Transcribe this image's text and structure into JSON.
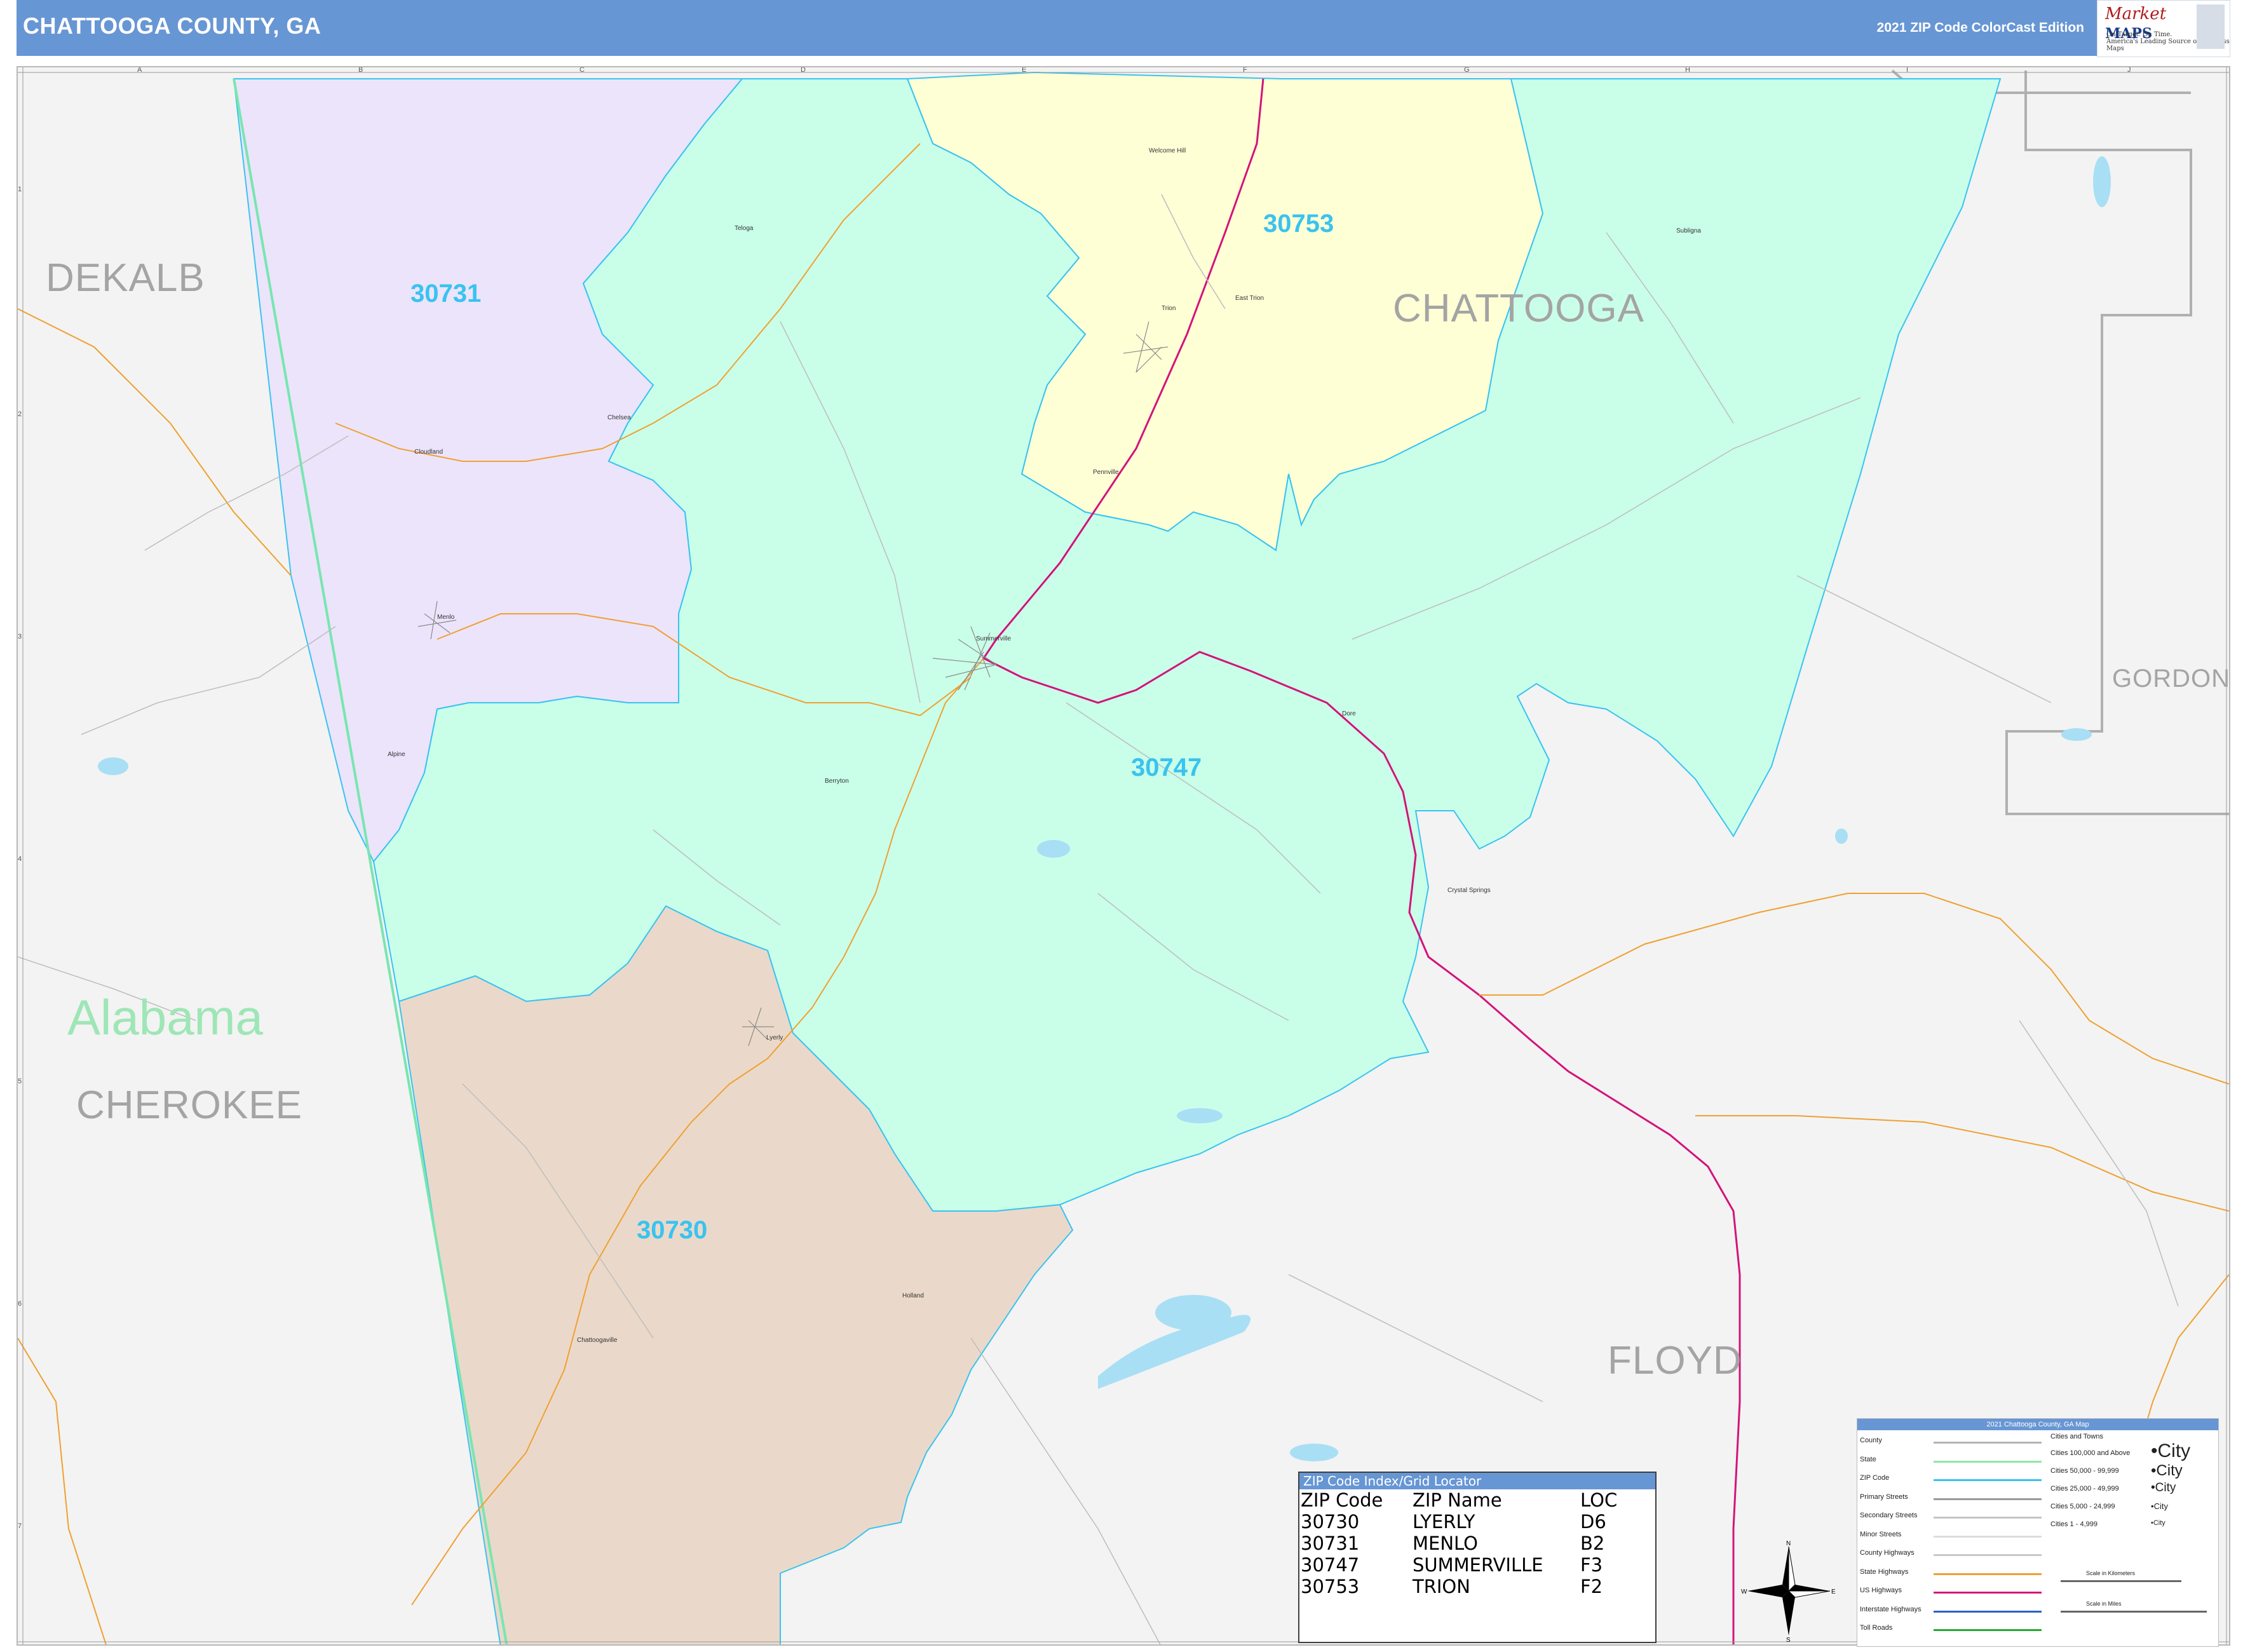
{
  "header": {
    "title": "CHATTOOGA COUNTY, GA",
    "edition": "2021 ZIP Code ColorCast Edition",
    "logo_brand_a": "arket",
    "logo_brand_b": "MAPS",
    "logo_tagline_1": "On Target. On Time.",
    "logo_tagline_2": "America's Leading Source of Business Maps"
  },
  "grid": {
    "letters": [
      "A",
      "B",
      "C",
      "D",
      "E",
      "F",
      "G",
      "H",
      "I",
      "J"
    ],
    "numbers": [
      "1",
      "2",
      "3",
      "4",
      "5",
      "6",
      "7"
    ]
  },
  "counties": [
    {
      "name": "DEKALB"
    },
    {
      "name": "CHATTOOGA"
    },
    {
      "name": "GORDON"
    },
    {
      "name": "CHEROKEE"
    },
    {
      "name": "FLOYD"
    }
  ],
  "state_label": "Alabama",
  "zip_areas": [
    {
      "zip": "30731",
      "color": "#ece4fb"
    },
    {
      "zip": "30753",
      "color": "#ffffd6"
    },
    {
      "zip": "30747",
      "color": "#c9ffe9"
    },
    {
      "zip": "30730",
      "color": "#ead9ca"
    }
  ],
  "places": [
    "Welcome Hill",
    "Teloga",
    "Trion",
    "East Trion",
    "Subligna",
    "Chelsea",
    "Cloudland",
    "Pennville",
    "Menlo",
    "Summerville",
    "Alpine",
    "Berryton",
    "Dore",
    "Crystal Springs",
    "Lyerly",
    "Holland",
    "Chattoogaville"
  ],
  "zip_index": {
    "title": "ZIP Code Index/Grid Locator",
    "headers": [
      "ZIP Code",
      "ZIP Name",
      "LOC"
    ],
    "rows": [
      [
        "30730",
        "LYERLY",
        "D6"
      ],
      [
        "30731",
        "MENLO",
        "B2"
      ],
      [
        "30747",
        "SUMMERVILLE",
        "F3"
      ],
      [
        "30753",
        "TRION",
        "F2"
      ]
    ]
  },
  "legend": {
    "title": "2021 Chattooga County, GA Map",
    "lines": [
      {
        "label": "County",
        "color": "#b4b4b4"
      },
      {
        "label": "State",
        "color": "#8fe6a8"
      },
      {
        "label": "ZIP Code",
        "color": "#39c3f0"
      },
      {
        "label": "Primary Streets",
        "color": "#9a9a9a"
      },
      {
        "label": "Secondary Streets",
        "color": "#c4c4c4"
      },
      {
        "label": "Minor Streets",
        "color": "#dddddd"
      },
      {
        "label": "County Highways",
        "color": "#c8c8c8"
      },
      {
        "label": "State Highways",
        "color": "#f0a030"
      },
      {
        "label": "US Highways",
        "color": "#d4137a"
      },
      {
        "label": "Interstate Highways",
        "color": "#2a60c8"
      },
      {
        "label": "Toll Roads",
        "color": "#22aa33"
      }
    ],
    "cities_title": "Cities and Towns",
    "city_sizes": [
      "Cities 100,000 and Above",
      "Cities 50,000 - 99,999",
      "Cities 25,000 - 49,999",
      "Cities 5,000 - 24,999",
      "Cities 1 - 4,999"
    ],
    "city_samples": [
      "City",
      "City",
      "City",
      "City",
      "City"
    ],
    "scale_km": "Scale in Kilometers",
    "scale_miles": "Scale in Miles"
  },
  "compass": {
    "n": "N",
    "s": "S",
    "e": "E",
    "w": "W"
  }
}
